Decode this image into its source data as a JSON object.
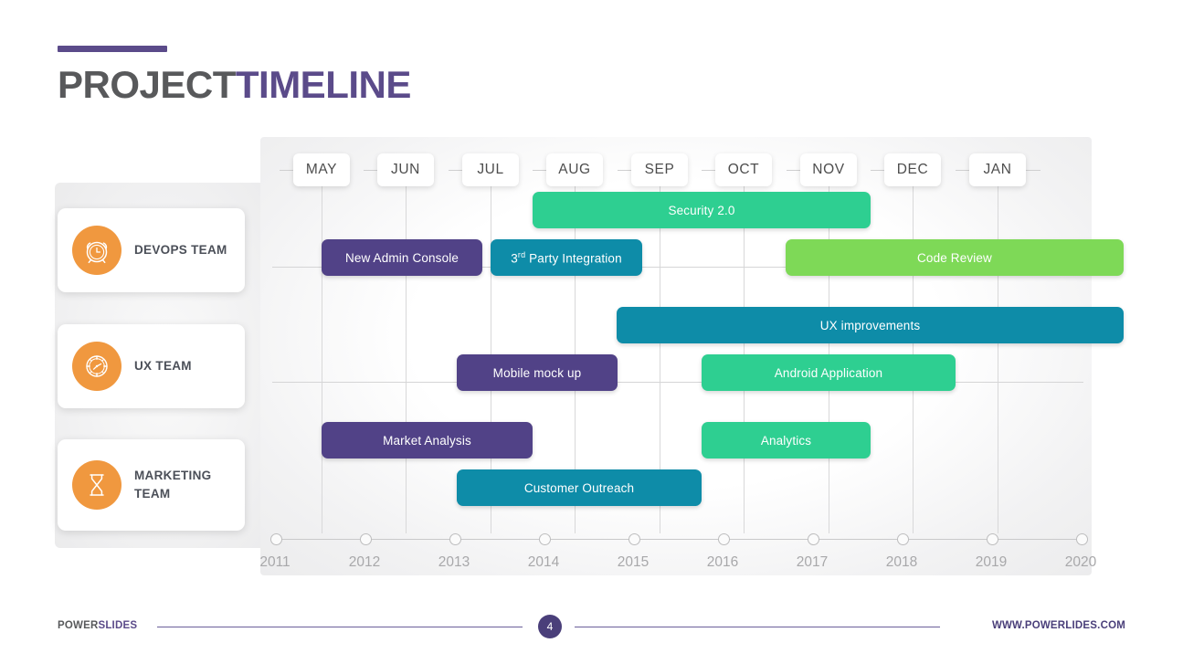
{
  "title": {
    "part1": "PROJECT",
    "part2": "TIMELINE"
  },
  "footer": {
    "brand_part1": "POWER",
    "brand_part2": "SLIDES",
    "page_number": "4",
    "url": "WWW.POWERLIDES.COM"
  },
  "teams": [
    {
      "label": "DEVOPS TEAM",
      "icon": "alarm-clock-icon"
    },
    {
      "label": "UX TEAM",
      "icon": "clock-compass-icon"
    },
    {
      "label": "MARKETING TEAM",
      "icon": "hourglass-icon"
    }
  ],
  "colors": {
    "purple": "#514287",
    "teal": "#0e8ca8",
    "green": "#2ecf91",
    "lime": "#7ed957",
    "accent_orange": "#f0983f",
    "title_purple": "#5b4b8a",
    "title_gray": "#58595b"
  },
  "chart_data": {
    "type": "bar",
    "title": "PROJECT TIMELINE",
    "xlabel": "",
    "ylabel": "",
    "grid": true,
    "legend_position": "none",
    "months": [
      "MAY",
      "JUN",
      "JUL",
      "AUG",
      "SEP",
      "OCT",
      "NOV",
      "DEC",
      "JAN"
    ],
    "years": [
      "2011",
      "2012",
      "2013",
      "2014",
      "2015",
      "2016",
      "2017",
      "2018",
      "2019",
      "2020"
    ],
    "rows": [
      "DEVOPS TEAM",
      "UX TEAM",
      "MARKETING TEAM"
    ],
    "tasks": [
      {
        "label": "Security 2.0",
        "row": "DEVOPS TEAM",
        "color": "#2ecf91",
        "start_month": "JUL",
        "end_month": "NOV",
        "start": 2.5,
        "end": 6.5
      },
      {
        "label": "New Admin Console",
        "row": "DEVOPS TEAM",
        "color": "#514287",
        "start_month": "MAY",
        "end_month": "JUL",
        "start": 0.0,
        "end": 1.9
      },
      {
        "label": "3rd Party Integration",
        "row": "DEVOPS TEAM",
        "color": "#0e8ca8",
        "start_month": "JUL",
        "end_month": "AUG",
        "start": 2.0,
        "end": 3.8,
        "superscript": "rd"
      },
      {
        "label": "Code Review",
        "row": "DEVOPS TEAM",
        "color": "#7ed957",
        "start_month": "OCT",
        "end_month": "JAN",
        "start": 5.5,
        "end": 9.5
      },
      {
        "label": "UX improvements",
        "row": "UX TEAM",
        "color": "#0e8ca8",
        "start_month": "AUG",
        "end_month": "JAN",
        "start": 3.5,
        "end": 9.5
      },
      {
        "label": "Mobile mock up",
        "row": "UX TEAM",
        "color": "#514287",
        "start_month": "JUN",
        "end_month": "AUG",
        "start": 1.6,
        "end": 3.5
      },
      {
        "label": "Android Application",
        "row": "UX TEAM",
        "color": "#2ecf91",
        "start_month": "SEP",
        "end_month": "DEC",
        "start": 4.5,
        "end": 7.5
      },
      {
        "label": "Market Analysis",
        "row": "MARKETING TEAM",
        "color": "#514287",
        "start_month": "MAY",
        "end_month": "JUL",
        "start": 0.0,
        "end": 2.5
      },
      {
        "label": "Analytics",
        "row": "MARKETING TEAM",
        "color": "#2ecf91",
        "start_month": "SEP",
        "end_month": "NOV",
        "start": 4.5,
        "end": 6.5
      },
      {
        "label": "Customer Outreach",
        "row": "MARKETING TEAM",
        "color": "#0e8ca8",
        "start_month": "JUN",
        "end_month": "SEP",
        "start": 1.6,
        "end": 4.5
      }
    ]
  }
}
